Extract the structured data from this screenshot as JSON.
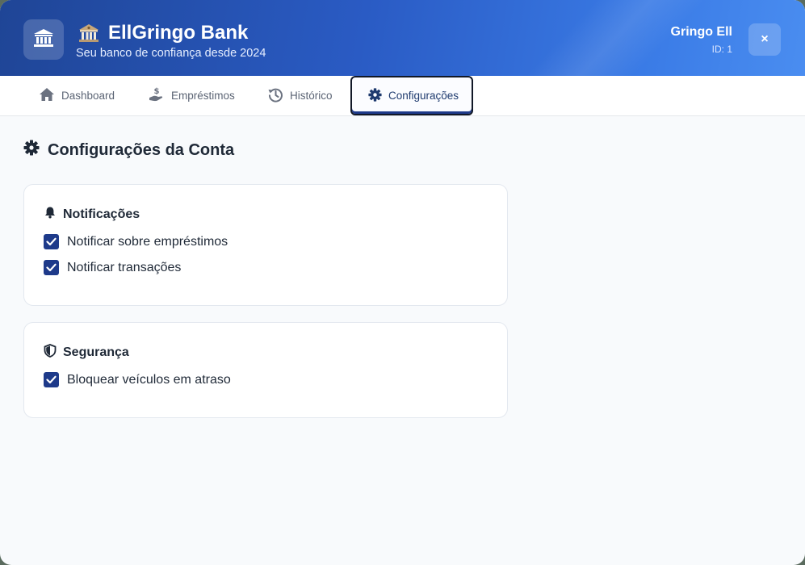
{
  "header": {
    "brand_emoji": "🏦",
    "title": "EllGringo Bank",
    "subtitle": "Seu banco de confiança desde 2024",
    "user_name": "Gringo Ell",
    "user_id": "ID: 1",
    "close_label": "×",
    "logo_icon": "bank-icon"
  },
  "tabs": [
    {
      "label": "Dashboard",
      "icon": "home-icon",
      "active": false
    },
    {
      "label": "Empréstimos",
      "icon": "hand-dollar-icon",
      "active": false
    },
    {
      "label": "Histórico",
      "icon": "history-icon",
      "active": false
    },
    {
      "label": "Configurações",
      "icon": "gear-icon",
      "active": true
    }
  ],
  "main": {
    "title": "Configurações da Conta",
    "notifications": {
      "title": "Notificações",
      "options": [
        {
          "label": "Notificar sobre empréstimos",
          "checked": true
        },
        {
          "label": "Notificar transações",
          "checked": true
        }
      ]
    },
    "security": {
      "title": "Segurança",
      "options": [
        {
          "label": "Bloquear veículos em atraso",
          "checked": true
        }
      ]
    }
  },
  "colors": {
    "header_start": "#1f4596",
    "header_end": "#4a8df0",
    "accent": "#1e3a8a",
    "page_bg": "#f8fafc",
    "text": "#1f2937"
  }
}
